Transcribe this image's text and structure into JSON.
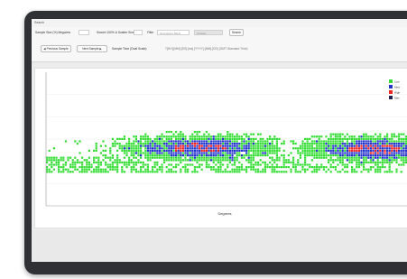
{
  "window": {
    "title": "Search"
  },
  "toolbar": {
    "sample_size_label": "Sample Size (%) Mega/ms",
    "sample_size_value": "",
    "search_label": "Search 100% & Scatter Size",
    "search_value": "",
    "filter_label": "Filter",
    "filter_placeholder": "Description Block",
    "filter_dropdown": "Choose",
    "filter_button": "Search",
    "prev_button": "Previous Sample",
    "next_button": "Next Sample",
    "sample_time_label": "Sample Time (Dual Scale):",
    "sample_time_value": "T[HH]:[MM]:[SS]:[ms] [YYYY]-[MM]-[DD] (GMT Standard Time)"
  },
  "chart_data": {
    "type": "heatmap",
    "xlabel": "Degrees",
    "ylabel": "",
    "legend_position": "top-right",
    "legend": [
      {
        "label": "Low",
        "color": "#33dd33"
      },
      {
        "label": "Med",
        "color": "#2233cc"
      },
      {
        "label": "High",
        "color": "#ee2222"
      },
      {
        "label": "Max",
        "color": "#222255"
      }
    ],
    "blobs": [
      {
        "cx": 0.41,
        "cy": 0.56,
        "rx": 0.22,
        "ry": 0.1
      },
      {
        "cx": 0.89,
        "cy": 0.57,
        "rx": 0.21,
        "ry": 0.1
      }
    ]
  }
}
